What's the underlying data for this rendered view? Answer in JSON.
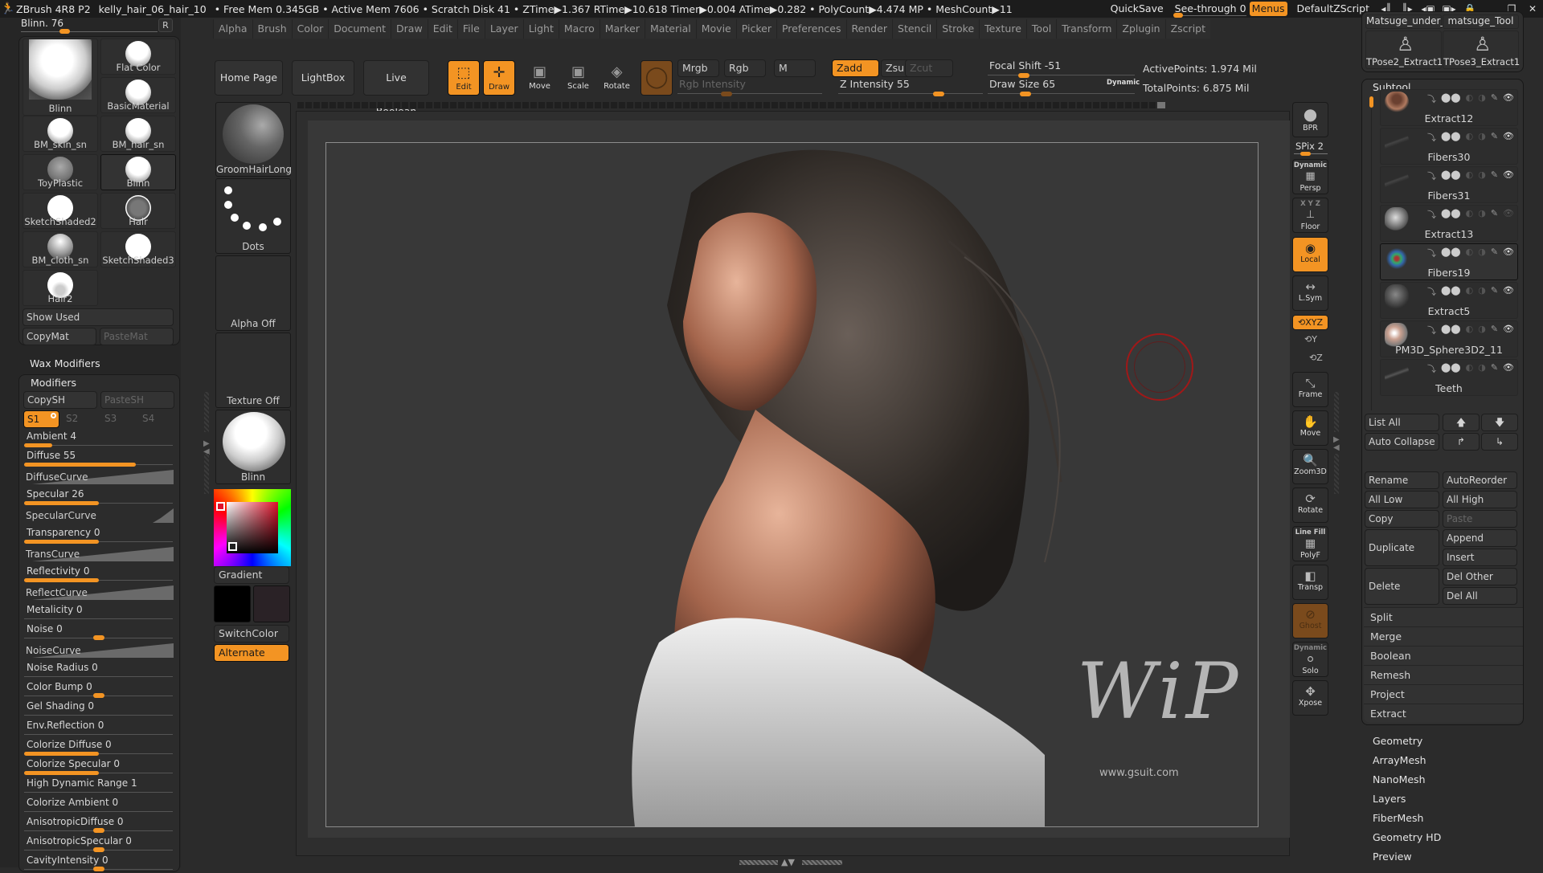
{
  "titlebar": {
    "app": "ZBrush 4R8 P2",
    "document": "kelly_hair_06_hair_10",
    "stats": "• Free Mem 0.345GB • Active Mem 7606 • Scratch Disk 41 • ZTime▶1.367 RTime▶10.618 Timer▶0.004 ATime▶0.282 • PolyCount▶4.474 MP • MeshCount▶11",
    "quicksave": "QuickSave",
    "seethrough": "See-through  0",
    "seethrough_value": 0,
    "menus": "Menus",
    "script": "DefaultZScript",
    "icons": [
      "interface-shrink-icon",
      "interface-expand-icon",
      "layout-prev-icon",
      "layout-next-icon",
      "lock-icon",
      "minimize-icon",
      "restore-icon",
      "close-icon"
    ]
  },
  "menubar": [
    "Alpha",
    "Brush",
    "Color",
    "Document",
    "Draw",
    "Edit",
    "File",
    "Layer",
    "Light",
    "Macro",
    "Marker",
    "Material",
    "Movie",
    "Picker",
    "Preferences",
    "Render",
    "Stencil",
    "Stroke",
    "Texture",
    "Tool",
    "Transform",
    "Zplugin",
    "Zscript"
  ],
  "material_panel": {
    "slider_label": "Blinn. 76",
    "slider_value": 76,
    "r_button": "R",
    "materials": [
      {
        "name": "Blinn",
        "selected": false,
        "big": true
      },
      {
        "name": "Flat Color"
      },
      {
        "name": "BasicMaterial"
      },
      {
        "name": "BM_skin_sn"
      },
      {
        "name": "BM_hair_sn"
      },
      {
        "name": "ToyPlastic"
      },
      {
        "name": "Blinn",
        "selected": true
      },
      {
        "name": "SketchShaded2"
      },
      {
        "name": "Hair"
      },
      {
        "name": "BM_cloth_sn"
      },
      {
        "name": "SketchShaded3"
      },
      {
        "name": "Hair2"
      }
    ],
    "show_used": "Show Used",
    "copy_mat": "CopyMat",
    "paste_mat": "PasteMat"
  },
  "modifiers": {
    "wax_title": "Wax Modifiers",
    "title": "Modifiers",
    "copy_sh": "CopySH",
    "paste_sh": "PasteSH",
    "shaders": [
      "S1",
      "S2",
      "S3",
      "S4"
    ],
    "active_shader": "S1",
    "rows": [
      {
        "type": "slider",
        "label": "Ambient 4",
        "value": 4,
        "fill": 0.19
      },
      {
        "type": "slider",
        "label": "Diffuse 55",
        "value": 55,
        "fill": 0.75
      },
      {
        "type": "curve",
        "label": "DiffuseCurve"
      },
      {
        "type": "slider",
        "label": "Specular 26",
        "value": 26,
        "fill": 0.5
      },
      {
        "type": "curve",
        "label": "SpecularCurve"
      },
      {
        "type": "slider",
        "label": "Transparency 0",
        "value": 0,
        "fill": 0.5
      },
      {
        "type": "curve",
        "label": "TransCurve"
      },
      {
        "type": "slider",
        "label": "Reflectivity 0",
        "value": 0,
        "fill": 0.5
      },
      {
        "type": "curve",
        "label": "ReflectCurve"
      },
      {
        "type": "plain",
        "label": "Metalicity 0"
      },
      {
        "type": "knob",
        "label": "Noise 0",
        "pos": 0.5
      },
      {
        "type": "curve",
        "label": "NoiseCurve"
      },
      {
        "type": "plain",
        "label": "Noise Radius 0"
      },
      {
        "type": "knob",
        "label": "Color Bump 0",
        "pos": 0.5
      },
      {
        "type": "plain",
        "label": "Gel Shading 0"
      },
      {
        "type": "plain",
        "label": "Env.Reflection 0"
      },
      {
        "type": "slider",
        "label": "Colorize Diffuse 0",
        "value": 0,
        "fill": 0.5
      },
      {
        "type": "slider",
        "label": "Colorize Specular 0",
        "value": 0,
        "fill": 0.5
      },
      {
        "type": "plain",
        "label": "High Dynamic Range 1"
      },
      {
        "type": "plain",
        "label": "Colorize Ambient 0"
      },
      {
        "type": "knob",
        "label": "AnisotropicDiffuse 0",
        "pos": 0.5
      },
      {
        "type": "knob",
        "label": "AnisotropicSpecular 0",
        "pos": 0.5
      },
      {
        "type": "knob",
        "label": "CavityIntensity 0",
        "pos": 0.5
      }
    ]
  },
  "column2": {
    "brush": "GroomHairLong",
    "stroke": "Dots",
    "alpha": "Alpha Off",
    "texture": "Texture Off",
    "material": "Blinn",
    "gradient": "Gradient",
    "switch_color": "SwitchColor",
    "alternate": "Alternate",
    "main_color": "#e0112a",
    "secondary_color": "#2a2226"
  },
  "toolbar": {
    "home_page": "Home Page",
    "lightbox": "LightBox",
    "live_boolean": "Live Boolean",
    "edit": "Edit",
    "draw": "Draw",
    "move": "Move",
    "scale": "Scale",
    "rotate": "Rotate",
    "mrgb": "Mrgb",
    "rgb": "Rgb",
    "m": "M",
    "zadd": "Zadd",
    "zsub": "Zsub",
    "zcut": "Zcut",
    "rgb_intensity": "Rgb Intensity",
    "z_intensity": "Z Intensity 55",
    "z_intensity_value": 55,
    "focal_shift": "Focal Shift -51",
    "focal_shift_value": -51,
    "draw_size": "Draw Size 65",
    "draw_size_value": 65,
    "dynamic": "Dynamic",
    "active_points": "ActivePoints: 1.974 Mil",
    "total_points": "TotalPoints: 6.875 Mil"
  },
  "canvas": {
    "watermark": "WiP",
    "watermark_url": "www.gsuit.com"
  },
  "shelf": {
    "bpr": "BPR",
    "spix": "SPix 2",
    "spix_value": 2,
    "persp_top": "Dynamic",
    "persp": "Persp",
    "floor_top": "X Y Z",
    "floor": "Floor",
    "local": "Local",
    "lsym": "L.Sym",
    "xyz": "XYZ",
    "rot_y": "Y",
    "rot_z": "Z",
    "frame": "Frame",
    "move": "Move",
    "zoom3d": "Zoom3D",
    "rotate": "Rotate",
    "polyf_top": "Line Fill",
    "polyf": "PolyF",
    "transp": "Transp",
    "ghost": "Ghost",
    "solo_top": "Dynamic",
    "solo": "Solo",
    "xpose": "Xpose"
  },
  "tool_palette": {
    "thumbs": [
      "Matsuge_under_",
      "matsuge_Tool",
      "TPose2_Extract1",
      "TPose3_Extract1"
    ]
  },
  "subtool": {
    "title": "Subtool",
    "items": [
      {
        "name": "Extract12",
        "selected": false,
        "visible": true
      },
      {
        "name": "Fibers30",
        "selected": false,
        "visible": true
      },
      {
        "name": "Fibers31",
        "selected": false,
        "visible": true
      },
      {
        "name": "Extract13",
        "selected": false,
        "visible": false
      },
      {
        "name": "Fibers19",
        "selected": true,
        "visible": true
      },
      {
        "name": "Extract5",
        "selected": false,
        "visible": true
      },
      {
        "name": "PM3D_Sphere3D2_11",
        "selected": false,
        "visible": true
      },
      {
        "name": "Teeth",
        "selected": false,
        "visible": true
      }
    ],
    "list_all": "List All",
    "auto_collapse": "Auto Collapse",
    "rename": "Rename",
    "auto_reorder": "AutoReorder",
    "all_low": "All Low",
    "all_high": "All High",
    "copy": "Copy",
    "paste": "Paste",
    "duplicate": "Duplicate",
    "append": "Append",
    "insert": "Insert",
    "delete": "Delete",
    "del_other": "Del Other",
    "del_all": "Del All",
    "sections": [
      "Split",
      "Merge",
      "Boolean",
      "Remesh",
      "Project",
      "Extract"
    ],
    "links": [
      "Geometry",
      "ArrayMesh",
      "NanoMesh",
      "Layers",
      "FiberMesh",
      "Geometry HD",
      "Preview"
    ]
  },
  "colors": {
    "accent": "#f39423",
    "background": "#2b2b2b",
    "canvas": "#383838",
    "brush_cursor": "#a01818"
  }
}
